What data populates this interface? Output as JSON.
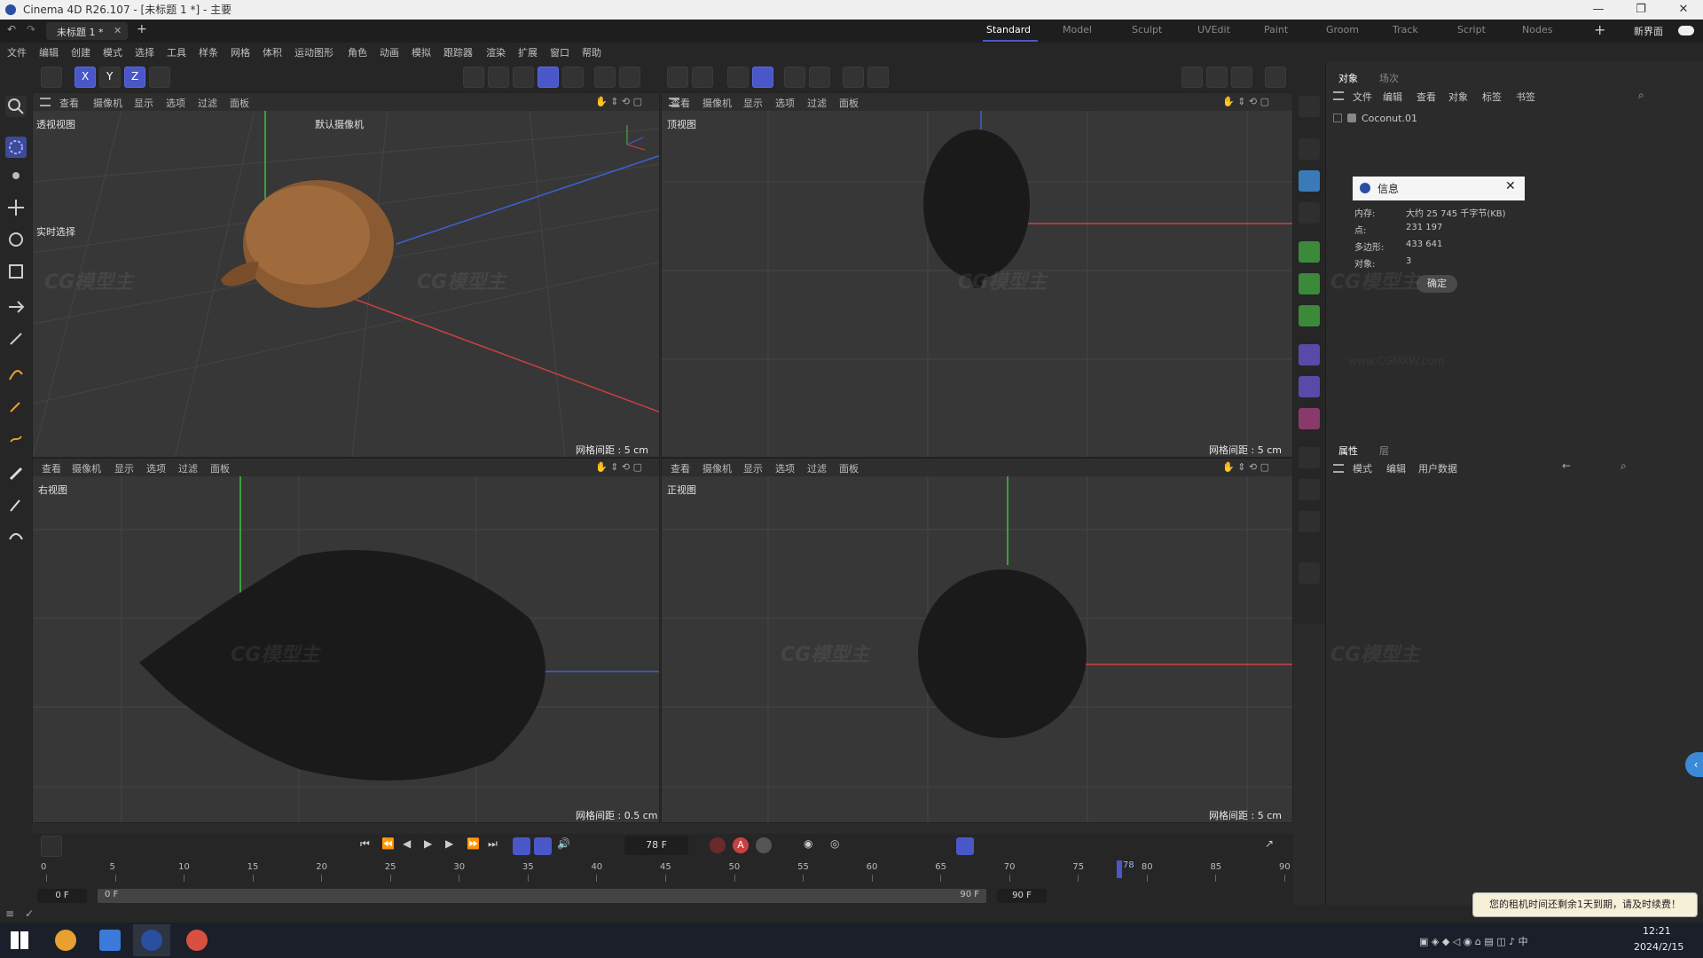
{
  "title": "Cinema 4D R26.107 - [未标题 1 *] - 主要",
  "doc_tab": "未标题 1 *",
  "layouts": [
    "Standard",
    "Model",
    "Sculpt",
    "UVEdit",
    "Paint",
    "Groom",
    "Track",
    "Script",
    "Nodes"
  ],
  "active_layout": "Standard",
  "new_layout": "新界面",
  "menu": [
    "文件",
    "编辑",
    "创建",
    "模式",
    "选择",
    "工具",
    "样条",
    "网格",
    "体积",
    "运动图形",
    "角色",
    "动画",
    "模拟",
    "跟踪器",
    "渲染",
    "扩展",
    "窗口",
    "帮助"
  ],
  "vp_menu": [
    "查看",
    "摄像机",
    "显示",
    "选项",
    "过滤",
    "面板"
  ],
  "viewports": {
    "persp": {
      "label": "透视视图",
      "camera": "默认摄像机",
      "realtime": "实时选择",
      "grid": "网格间距 : 5 cm"
    },
    "top": {
      "label": "顶视图",
      "grid": "网格间距 : 5 cm"
    },
    "right": {
      "label": "右视图",
      "grid": "网格间距 : 0.5 cm"
    },
    "front": {
      "label": "正视图",
      "grid": "网格间距 : 5 cm"
    }
  },
  "object_panel": {
    "tabs": [
      "对象",
      "场次"
    ],
    "menu": [
      "文件",
      "编辑",
      "查看",
      "对象",
      "标签",
      "书签"
    ],
    "object_name": "Coconut.01"
  },
  "info_dialog": {
    "title": "信息",
    "rows": [
      {
        "label": "内存:",
        "value": "大约 25 745 千字节(KB)"
      },
      {
        "label": "点:",
        "value": "231 197"
      },
      {
        "label": "多边形:",
        "value": "433 641"
      },
      {
        "label": "对象:",
        "value": "3"
      }
    ],
    "ok": "确定"
  },
  "attr_panel": {
    "tabs": [
      "属性",
      "层"
    ],
    "menu": [
      "模式",
      "编辑",
      "用户数据"
    ]
  },
  "timeline": {
    "current_frame": "78 F",
    "ticks": [
      "0",
      "5",
      "10",
      "15",
      "20",
      "25",
      "30",
      "35",
      "40",
      "45",
      "50",
      "55",
      "60",
      "65",
      "70",
      "75",
      "80",
      "85",
      "90"
    ],
    "playhead_value": "78",
    "start": "0 F",
    "start2": "0 F",
    "end": "90 F",
    "end2": "90 F"
  },
  "watermark": "CG模型主",
  "watermark_url": "www.CGMXW.com",
  "notice": "您的租机时间还剩余1天到期，请及时续费！",
  "clock": {
    "time": "12:21",
    "date": "2024/2/15"
  },
  "colors": {
    "accent": "#4a57c8",
    "x_axis": "#d04040",
    "y_axis": "#40c040",
    "z_axis": "#4060d0"
  }
}
